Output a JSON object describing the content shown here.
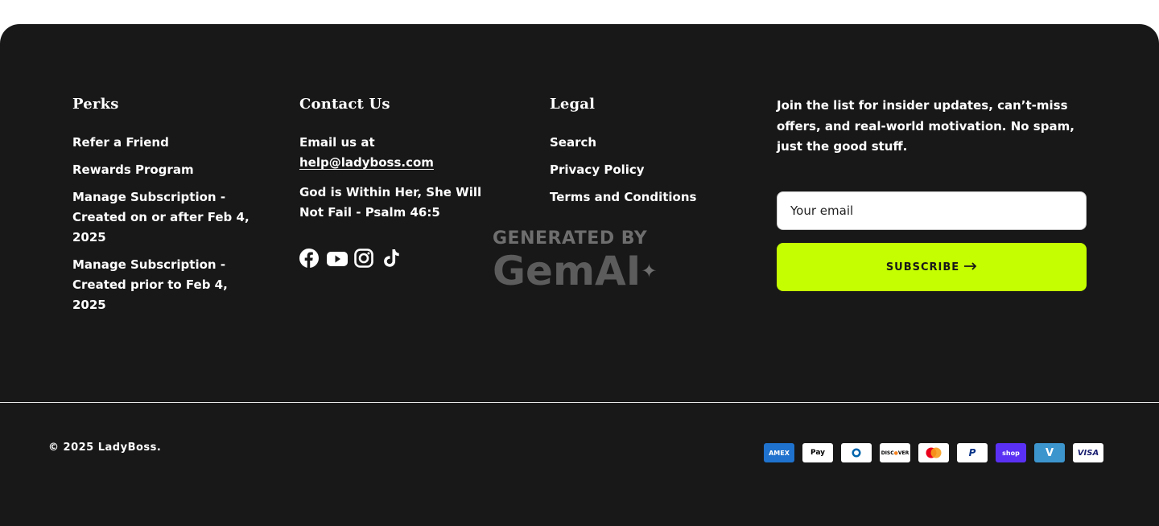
{
  "perks": {
    "heading": "Perks",
    "links": [
      "Refer a Friend",
      "Rewards Program",
      "Manage Subscription - Created on or after Feb 4, 2025",
      "Manage Subscription - Created prior to Feb 4, 2025"
    ]
  },
  "contact": {
    "heading": "Contact Us",
    "email_prefix": "Email us at",
    "email": "help@ladyboss.com",
    "tagline": "God is Within Her, She Will Not Fail - Psalm 46:5",
    "social_icons": [
      "facebook-icon",
      "youtube-icon",
      "instagram-icon",
      "tiktok-icon"
    ]
  },
  "legal": {
    "heading": "Legal",
    "links": [
      "Search",
      "Privacy Policy",
      "Terms and Conditions"
    ]
  },
  "newsletter": {
    "text": "Join the list for insider updates, can’t-miss offers, and real-world motivation. No spam, just the good stuff.",
    "placeholder": "Your email",
    "button_label": "SUBSCRIBE",
    "accent": "#c4fe00"
  },
  "watermark": {
    "line1": "GENERATED BY",
    "line2": "GemAI"
  },
  "bottom": {
    "copyright": "© 2025 LadyBoss.",
    "payment_icons": [
      "american-express-icon",
      "apple-pay-icon",
      "diners-club-icon",
      "discover-icon",
      "mastercard-icon",
      "paypal-icon",
      "shop-pay-icon",
      "venmo-icon",
      "visa-icon"
    ]
  },
  "colors": {
    "background": "#181818",
    "text": "#ffffff",
    "accent": "#c4fe00"
  }
}
